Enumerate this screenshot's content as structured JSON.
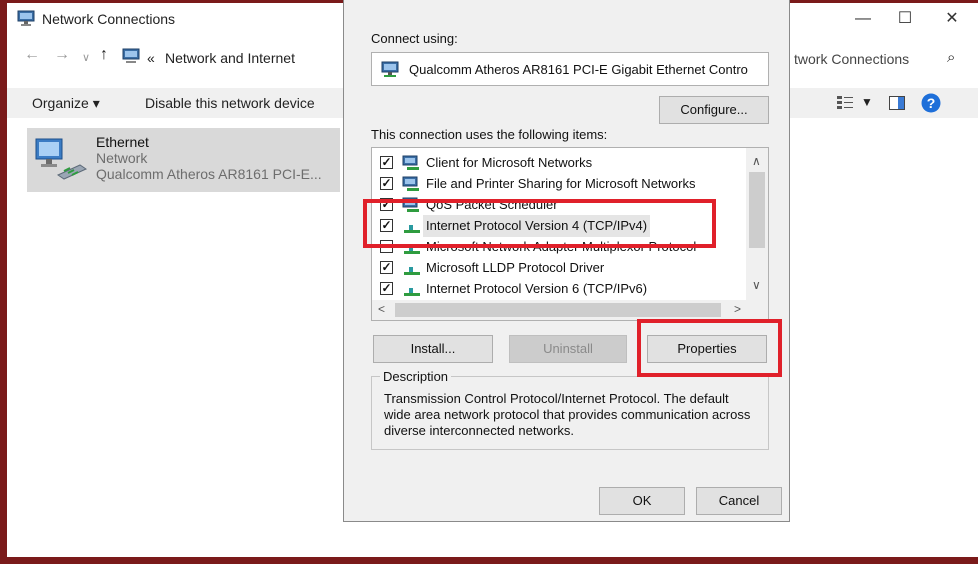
{
  "window": {
    "title": "Network Connections",
    "minimize": "—",
    "maximize": "☐",
    "close": "✕"
  },
  "address": {
    "chevron": "«",
    "path": "Network and Internet",
    "search_placeholder": "twork Connections"
  },
  "commandbar": {
    "organize": "Organize ▾",
    "disable": "Disable this network device"
  },
  "connection": {
    "name": "Ethernet",
    "status": "Network",
    "adapter": "Qualcomm Atheros AR8161 PCI-E..."
  },
  "dialog": {
    "connect_using_label": "Connect using:",
    "adapter_name": "Qualcomm Atheros AR8161 PCI-E Gigabit Ethernet Contro",
    "configure_button": "Configure...",
    "items_label": "This connection uses the following items:",
    "items": [
      {
        "checked": true,
        "label": "Client for Microsoft Networks",
        "icon": "network-client-icon"
      },
      {
        "checked": true,
        "label": "File and Printer Sharing for Microsoft Networks",
        "icon": "file-sharing-icon"
      },
      {
        "checked": true,
        "label": "QoS Packet Scheduler",
        "icon": "qos-icon"
      },
      {
        "checked": true,
        "label": "Internet Protocol Version 4 (TCP/IPv4)",
        "icon": "protocol-icon",
        "selected": true
      },
      {
        "checked": false,
        "label": "Microsoft Network Adapter Multiplexor Protocol",
        "icon": "protocol-icon"
      },
      {
        "checked": true,
        "label": "Microsoft LLDP Protocol Driver",
        "icon": "protocol-icon"
      },
      {
        "checked": true,
        "label": "Internet Protocol Version 6 (TCP/IPv6)",
        "icon": "protocol-icon"
      }
    ],
    "install_button": "Install...",
    "uninstall_button": "Uninstall",
    "properties_button": "Properties",
    "description_label": "Description",
    "description_text": "Transmission Control Protocol/Internet Protocol. The default wide area network protocol that provides communication across diverse interconnected networks.",
    "ok_button": "OK",
    "cancel_button": "Cancel"
  },
  "colors": {
    "highlight_red": "#e0202a",
    "frame": "#7a1a1a"
  }
}
